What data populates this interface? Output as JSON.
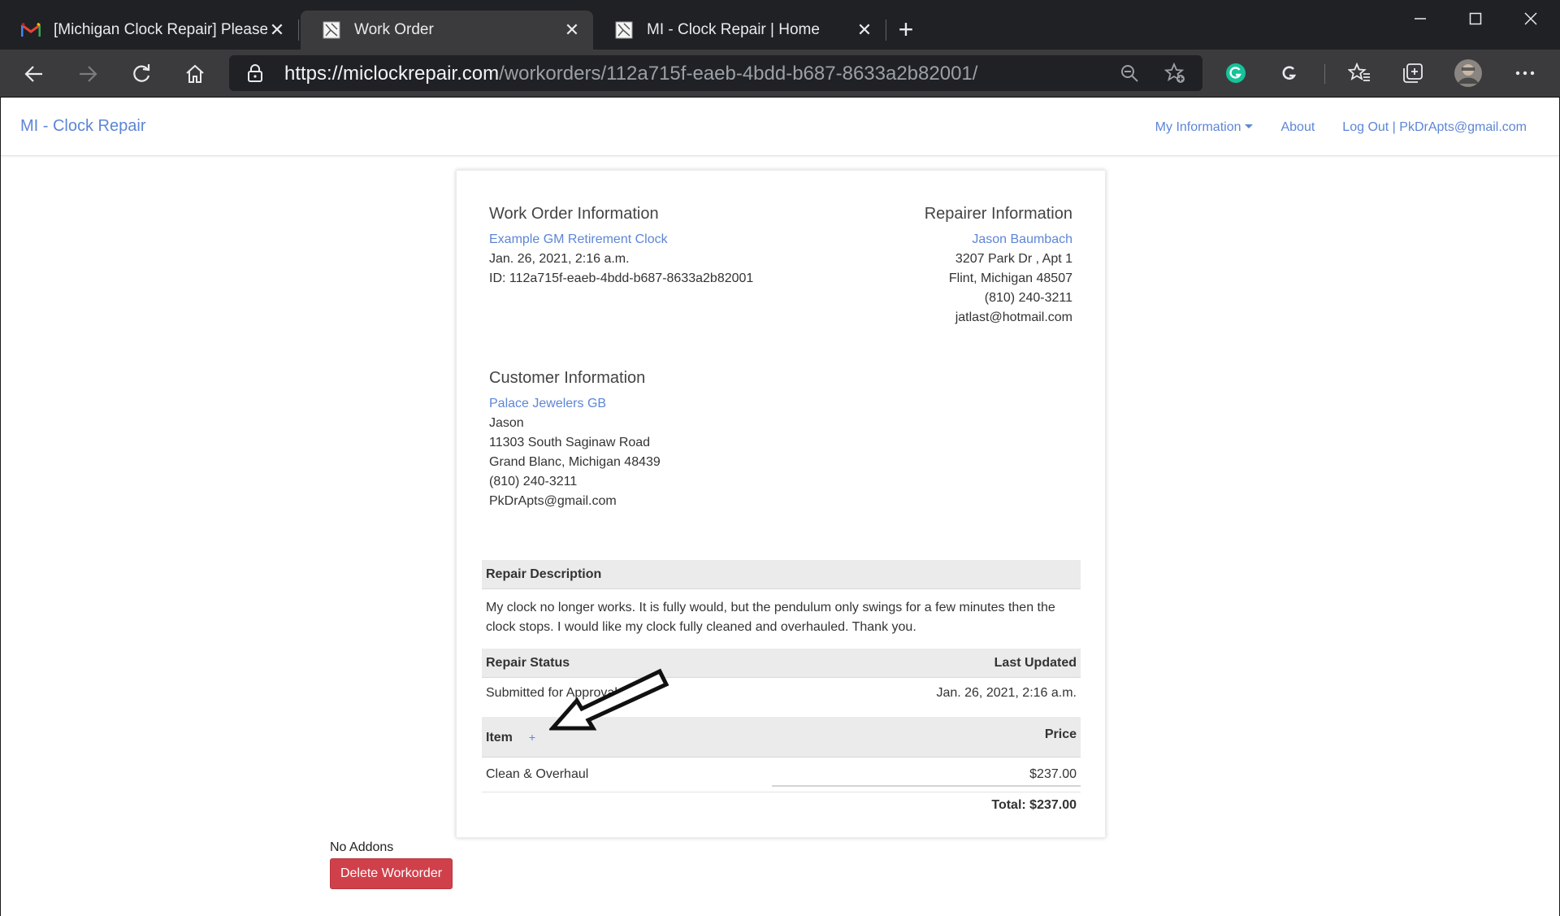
{
  "browser": {
    "tabs": [
      {
        "title": "[Michigan Clock Repair] Please C",
        "icon": "gmail-icon",
        "active": false
      },
      {
        "title": "Work Order",
        "icon": "site-favicon",
        "active": true
      },
      {
        "title": "MI - Clock Repair | Home",
        "icon": "site-favicon",
        "active": false
      }
    ],
    "new_tab_label": "+",
    "url_host": "https://miclockrepair.com",
    "url_path": "/workorders/112a715f-eaeb-4bdd-b687-8633a2b82001/",
    "colors": {
      "tabbar": "#202124",
      "toolbar": "#3b3b3d",
      "grammarly": "#15c39a"
    }
  },
  "navbar": {
    "brand": "MI - Clock Repair",
    "my_information": "My Information",
    "about": "About",
    "logout": "Log Out | PkDrApts@gmail.com",
    "link_color": "#5d86d6"
  },
  "work_order": {
    "heading": "Work Order Information",
    "title": "Example GM Retirement Clock",
    "date": "Jan. 26, 2021, 2:16 a.m.",
    "id": "ID: 112a715f-eaeb-4bdd-b687-8633a2b82001"
  },
  "repairer": {
    "heading": "Repairer Information",
    "name": "Jason Baumbach",
    "address1": "3207 Park Dr , Apt 1",
    "address2": "Flint, Michigan 48507",
    "phone": "(810) 240-3211",
    "email": "jatlast@hotmail.com"
  },
  "customer": {
    "heading": "Customer Information",
    "company": "Palace Jewelers GB",
    "contact": "Jason",
    "address1": "11303 South Saginaw Road",
    "address2": "Grand Blanc, Michigan 48439",
    "phone": "(810) 240-3211",
    "email": "PkDrApts@gmail.com"
  },
  "repair": {
    "description_header": "Repair Description",
    "description": "My clock no longer works. It is fully would, but the pendulum only swings for a few minutes then the clock stops. I would like my clock fully cleaned and overhauled. Thank you.",
    "status_header": "Repair Status",
    "last_updated_header": "Last Updated",
    "status": "Submitted for Approval",
    "last_updated": "Jan. 26, 2021, 2:16 a.m."
  },
  "items": {
    "item_header": "Item",
    "add_label": "+",
    "price_header": "Price",
    "rows": [
      {
        "name": "Clean & Overhaul",
        "price": "$237.00"
      }
    ],
    "total": "Total: $237.00"
  },
  "addons_text": "No Addons",
  "delete_button": "Delete Workorder",
  "delete_color": "#d0404b"
}
